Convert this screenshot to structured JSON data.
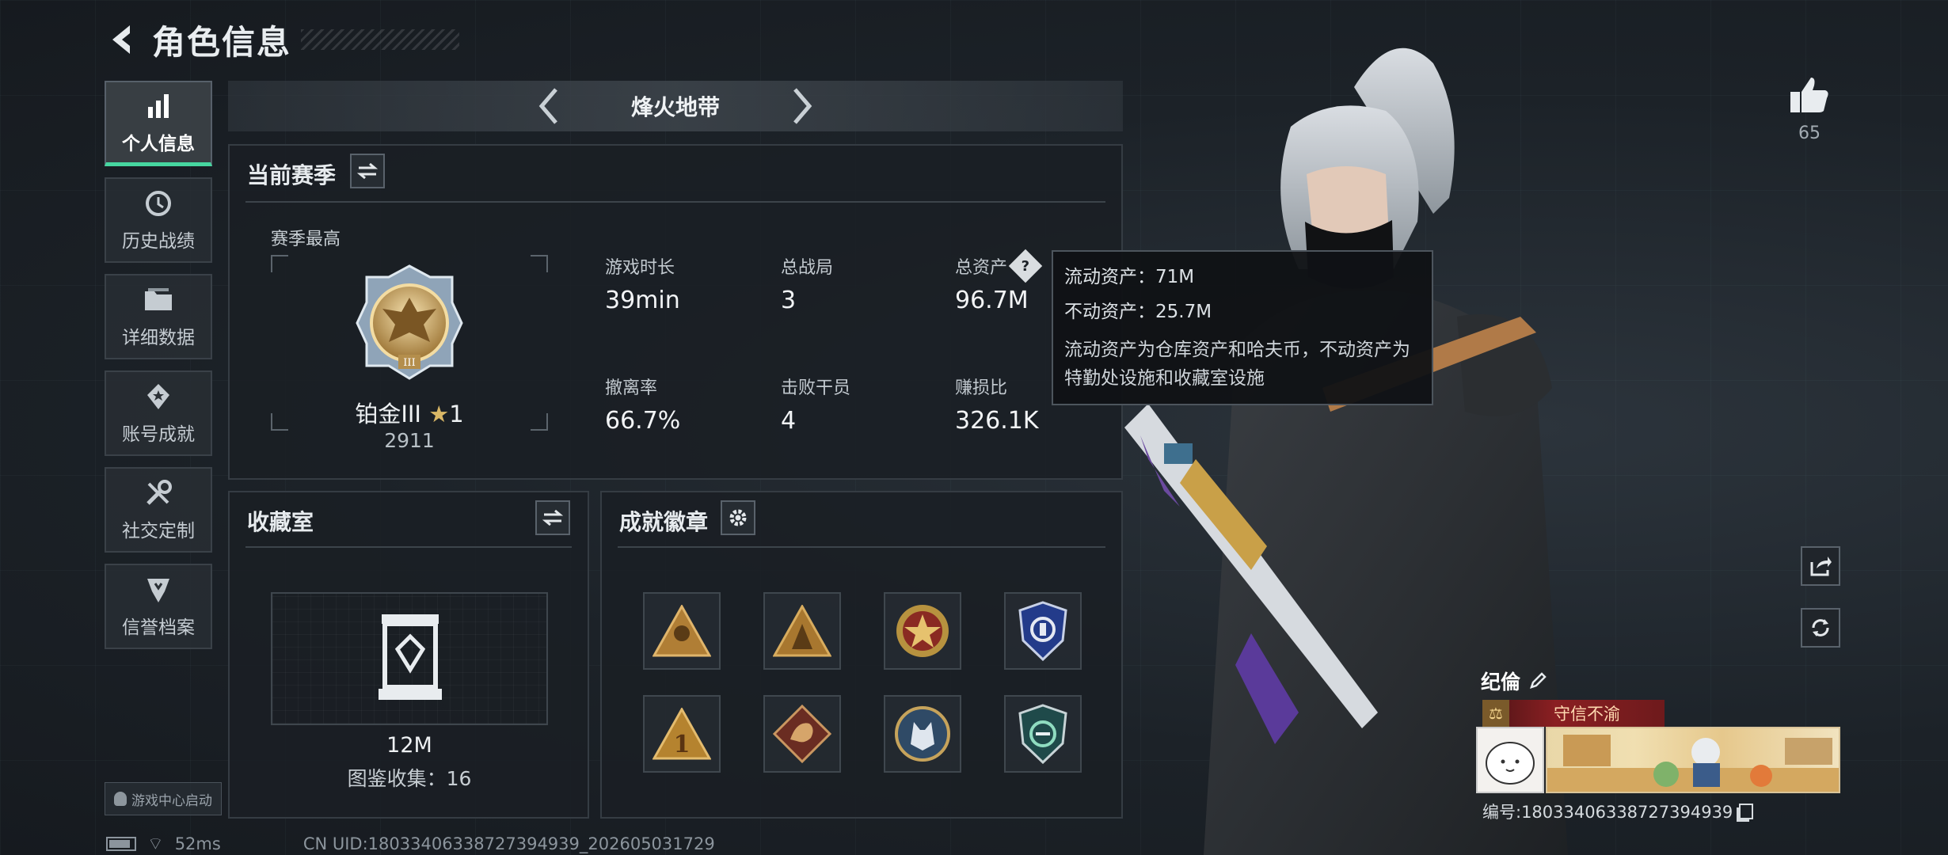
{
  "header": {
    "title": "角色信息"
  },
  "nav": [
    {
      "label": "个人信息",
      "icon": "bar-chart-icon",
      "active": true
    },
    {
      "label": "历史战绩",
      "icon": "history-icon"
    },
    {
      "label": "详细数据",
      "icon": "folder-icon"
    },
    {
      "label": "账号成就",
      "icon": "achievement-icon"
    },
    {
      "label": "社交定制",
      "icon": "tools-icon"
    },
    {
      "label": "信誉档案",
      "icon": "credit-shield-icon"
    }
  ],
  "launch": {
    "label": "游戏中心启动"
  },
  "mode": {
    "name": "烽火地带"
  },
  "season": {
    "title": "当前赛季",
    "subtitle": "赛季最高",
    "rank_name": "铂金III",
    "rank_stars": "1",
    "rank_score": "2911",
    "stats": [
      {
        "label": "游戏时长",
        "value": "39min"
      },
      {
        "label": "总战局",
        "value": "3"
      },
      {
        "label": "总资产",
        "value": "96.7M"
      },
      {
        "label": "撤离率",
        "value": "66.7%"
      },
      {
        "label": "击败干员",
        "value": "4"
      },
      {
        "label": "赚损比",
        "value": "326.1K"
      }
    ]
  },
  "tooltip": {
    "liquid": "流动资产：71M",
    "fixed": "不动资产：25.7M",
    "desc": "流动资产为仓库资产和哈夫币，不动资产为特勤处设施和收藏室设施"
  },
  "collection": {
    "title": "收藏室",
    "value": "12M",
    "count": "图鉴收集：16"
  },
  "badges": {
    "title": "成就徽章",
    "items": [
      "gold-triangle-badge",
      "gold-triangle-badge-2",
      "red-star-badge",
      "blue-shield-badge",
      "number-one-badge",
      "dragon-badge",
      "wolf-badge",
      "green-shield-badge"
    ]
  },
  "status": {
    "ping": "52ms",
    "uid": "CN UID:18033406338727394939_202605031729"
  },
  "like": {
    "count": "65"
  },
  "player": {
    "name": "纪倫",
    "honor": "守信不渝",
    "id": "编号:18033406338727394939"
  },
  "colors": {
    "accent": "#46d6a0",
    "gold": "#c9a45a",
    "honor_red": "#8a1f22"
  }
}
